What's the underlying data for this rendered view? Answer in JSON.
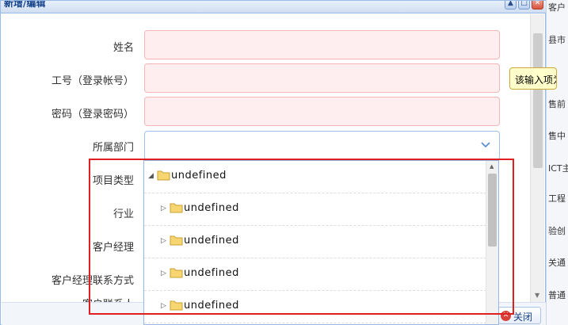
{
  "dialog": {
    "title": "新增/编辑",
    "window_buttons": {
      "minimize": "▲",
      "maximize": "□",
      "close": "✕"
    }
  },
  "form": {
    "name_label": "姓名",
    "employee_id_label": "工号（登录帐号）",
    "password_label": "密码（登录密码）",
    "department_label": "所属部门",
    "project_type_label": "项目类型",
    "industry_label": "行业",
    "account_manager_label": "客户经理",
    "manager_contact_label": "客户经理联系方式",
    "customer_contact_label": "客户联系人"
  },
  "tooltip": {
    "text": "该输入项为必"
  },
  "tree": {
    "nodes": [
      {
        "label": "undefined",
        "expanded": true,
        "level": 0
      },
      {
        "label": "undefined",
        "expanded": false,
        "level": 1
      },
      {
        "label": "undefined",
        "expanded": false,
        "level": 1
      },
      {
        "label": "undefined",
        "expanded": false,
        "level": 1
      },
      {
        "label": "undefined",
        "expanded": false,
        "level": 1
      }
    ]
  },
  "footer": {
    "close_label": "关闭"
  },
  "background_list": [
    "客户",
    "县市",
    "售前",
    "售中",
    "ICT主",
    "工程",
    "验创",
    "关通",
    "普通"
  ],
  "colors": {
    "highlight": "#e02020",
    "required_field_bg": "#ffeef0",
    "accent": "#15428b"
  }
}
